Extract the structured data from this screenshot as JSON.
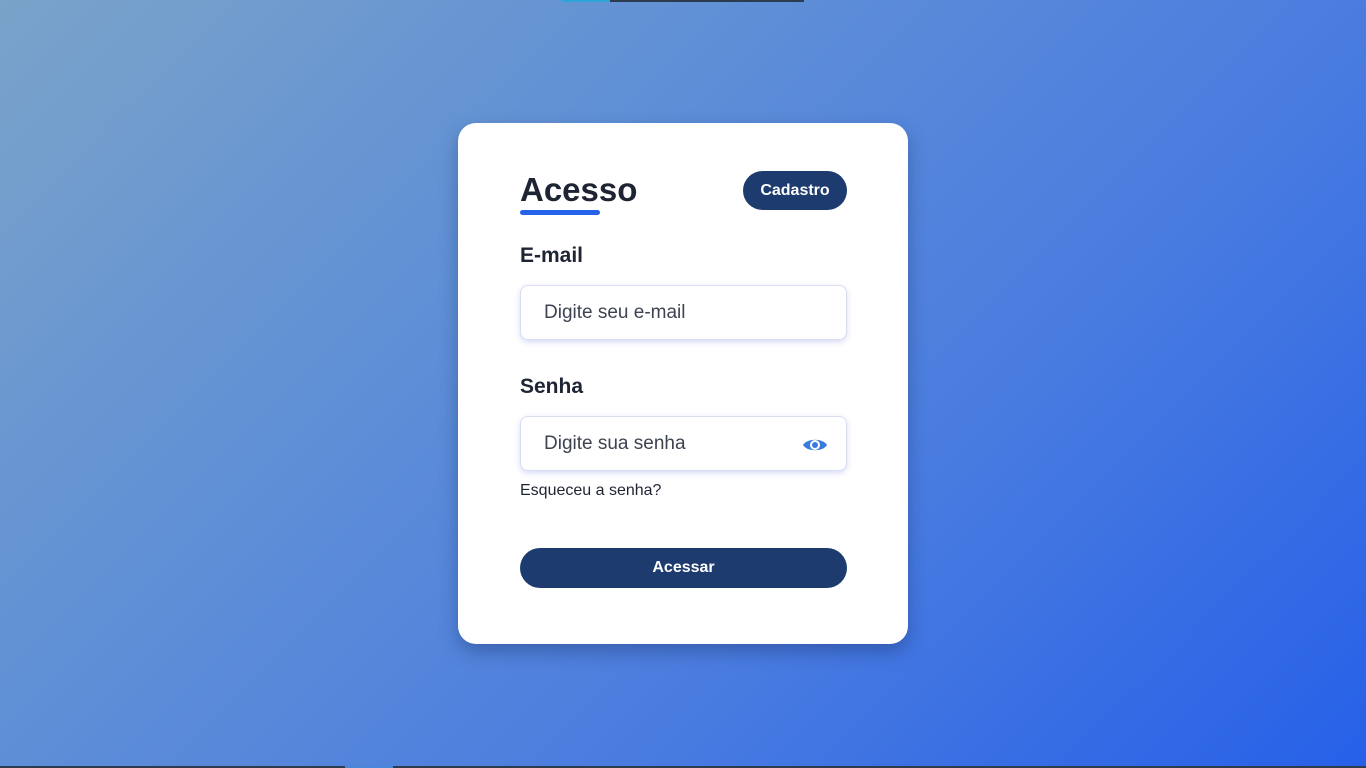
{
  "login": {
    "title": "Acesso",
    "signup_label": "Cadastro",
    "email": {
      "label": "E-mail",
      "value": "",
      "placeholder": "Digite seu e-mail"
    },
    "password": {
      "label": "Senha",
      "value": "",
      "placeholder": "Digite sua senha",
      "toggle_icon": "eye-icon"
    },
    "forgot_label": "Esqueceu a senha?",
    "submit_label": "Acessar"
  },
  "colors": {
    "accent": "#2563eb",
    "button": "#1d3b6e",
    "text": "#1e2433",
    "card": "#ffffff",
    "background_start": "#7aa3c9",
    "background_end": "#2660e8"
  }
}
